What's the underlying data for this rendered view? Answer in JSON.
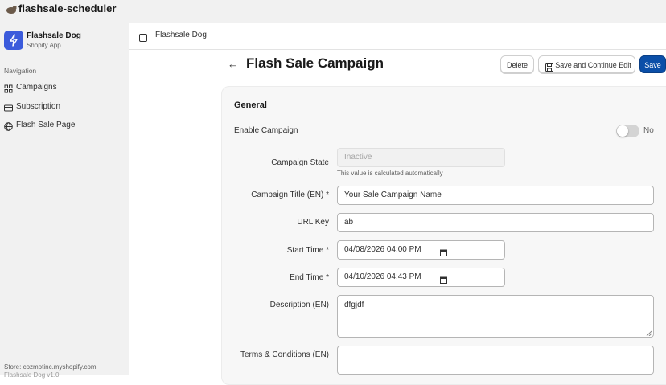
{
  "window": {
    "title": "flashsale-scheduler"
  },
  "sidebar": {
    "app_name": "Flashsale Dog",
    "app_subtitle": "Shopify App",
    "nav_heading": "Navigation",
    "items": [
      {
        "label": "Campaigns",
        "icon": "grid-icon"
      },
      {
        "label": "Subscription",
        "icon": "credit-card-icon"
      },
      {
        "label": "Flash Sale Page",
        "icon": "globe-icon"
      }
    ],
    "store_label": "Store: cozmotinc.myshopify.com",
    "store_sub": "Flashsale Dog v1.0"
  },
  "header": {
    "app_label": "Flashsale Dog"
  },
  "page": {
    "title": "Flash Sale Campaign",
    "actions": {
      "delete": "Delete",
      "save_continue": "Save and Continue Edit",
      "save": "Save"
    }
  },
  "form": {
    "section_title": "General",
    "enable_label": "Enable Campaign",
    "enable_value": "No",
    "fields": {
      "state": {
        "label": "Campaign State",
        "value": "Inactive",
        "help": "This value is calculated automatically"
      },
      "title": {
        "label": "Campaign Title (EN) *",
        "value": "Your Sale Campaign Name"
      },
      "url_key": {
        "label": "URL Key",
        "value": "ab"
      },
      "start": {
        "label": "Start Time *",
        "value": "04/08/2026 04:00 PM"
      },
      "end": {
        "label": "End Time *",
        "value": "04/10/2026 04:43 PM"
      },
      "description": {
        "label": "Description (EN)",
        "value": "dfgjdf"
      },
      "terms": {
        "label": "Terms & Conditions (EN)",
        "value": ""
      }
    }
  },
  "colors": {
    "primary": "#0b4fa8",
    "brand": "#3b5bdb",
    "sidebar_bg": "#f1f1f1"
  }
}
